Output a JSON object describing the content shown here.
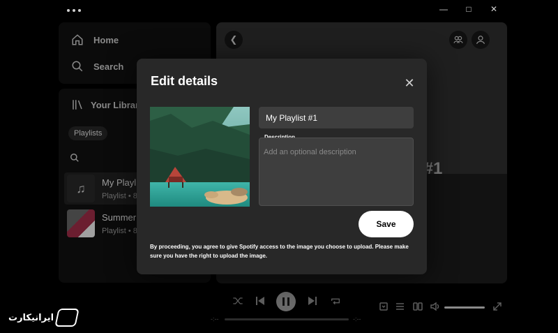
{
  "window": {
    "menu_icon": "more-dots-icon",
    "controls": [
      "minimize-icon",
      "maximize-icon",
      "close-icon"
    ]
  },
  "sidebar": {
    "home_label": "Home",
    "search_label": "Search",
    "library_label": "Your Library",
    "filter_chip": "Playlists",
    "items": [
      {
        "title": "My Playlist #1",
        "subtitle": "Playlist • 8"
      },
      {
        "title": "Summer Hits",
        "subtitle": "Playlist • 8"
      }
    ]
  },
  "main": {
    "title_fragment": "t #1"
  },
  "dialog": {
    "title": "Edit details",
    "name_value": "My Playlist #1",
    "description_label": "Description",
    "description_placeholder": "Add an optional description",
    "save_label": "Save",
    "disclaimer": "By proceeding, you agree to give Spotify access to the image you choose to upload. Please make sure you have the right to upload the image."
  },
  "player": {
    "elapsed": "-:--",
    "duration": "-:--"
  },
  "watermark": {
    "text": "ایرانیکارت"
  }
}
